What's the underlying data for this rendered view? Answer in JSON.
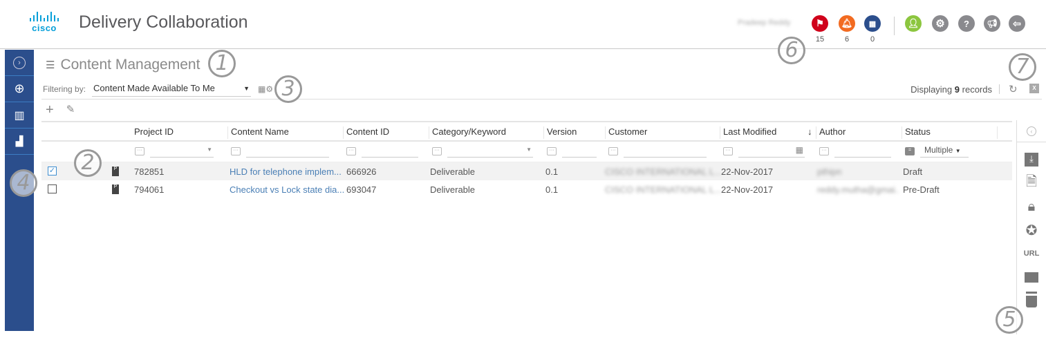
{
  "header": {
    "logo_text": "cisco",
    "app_title": "Delivery Collaboration",
    "user_name": "Pradeep Reddy",
    "notifications": [
      {
        "icon": "flag-icon",
        "count": "15",
        "color": "#d0021b"
      },
      {
        "icon": "bell-icon",
        "count": "6",
        "color": "#f26b21"
      },
      {
        "icon": "calendar-icon",
        "count": "0",
        "color": "#2b4e8c"
      }
    ],
    "actions": [
      {
        "icon": "user-icon",
        "color": "#8cc63f"
      },
      {
        "icon": "gear-icon",
        "color": "#8a8a8e"
      },
      {
        "icon": "help-icon",
        "color": "#8a8a8e"
      },
      {
        "icon": "megaphone-icon",
        "color": "#8a8a8e"
      },
      {
        "icon": "logout-icon",
        "color": "#8a8a8e"
      }
    ]
  },
  "leftnav": {
    "items": [
      "expand-icon",
      "globe-icon",
      "building-icon",
      "dashboard-icon"
    ],
    "color": "#2b4e8c"
  },
  "page": {
    "title": "Content Management",
    "filter_label": "Filtering by:",
    "filter_value": "Content Made Available To Me",
    "records_prefix": "Displaying",
    "records_count": "9",
    "records_suffix": "records"
  },
  "grid": {
    "columns": [
      "Project ID",
      "Content Name",
      "Content ID",
      "Category/Keyword",
      "Version",
      "Customer",
      "Last Modified",
      "Author",
      "Status"
    ],
    "sort_indicator": "↓",
    "status_filter_value": "Multiple",
    "rows": [
      {
        "selected": true,
        "project_id": "782851",
        "content_name": "HLD for telephone implem...",
        "content_id": "666926",
        "category": "Deliverable",
        "version": "0.1",
        "customer": "CISCO INTERNATIONAL L...",
        "last_modified": "22-Nov-2017",
        "author": "pthipn",
        "status": "Draft"
      },
      {
        "selected": false,
        "project_id": "794061",
        "content_name": "Checkout vs Lock state dia...",
        "content_id": "693047",
        "category": "Deliverable",
        "version": "0.1",
        "customer": "CISCO INTERNATIONAL L...",
        "last_modified": "22-Nov-2017",
        "author": "reddy.mutha@gmai...",
        "status": "Pre-Draft"
      }
    ]
  },
  "actionbar": {
    "url_label": "URL",
    "items": [
      "download-icon",
      "doc-lock-icon",
      "lock-icon",
      "verified-icon",
      "url-icon",
      "archive-icon",
      "delete-icon"
    ]
  },
  "callouts": [
    "1",
    "2",
    "3",
    "4",
    "5",
    "6",
    "7"
  ]
}
